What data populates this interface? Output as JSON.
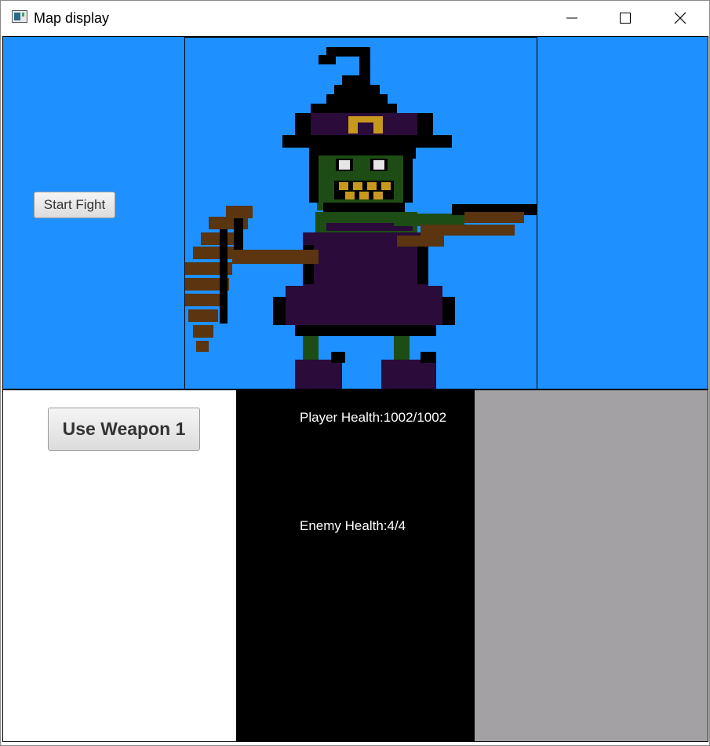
{
  "window": {
    "title": "Map display",
    "icon": "app-window-icon",
    "controls": [
      "minimize-icon",
      "maximize-icon",
      "close-icon"
    ]
  },
  "colors": {
    "top_background": "#1e90ff",
    "stats_background": "#000000",
    "right_panel": "#a3a1a3",
    "stat_text": "#ffffff"
  },
  "top_panel": {
    "start_fight_label": "Start Fight",
    "enemy_sprite": "witch-goblin-sprite"
  },
  "actions": {
    "use_weapon_1_label": "Use Weapon 1"
  },
  "stats": {
    "player_health": "Player Health:1002/1002",
    "enemy_health": "Enemy Health:4/4"
  }
}
